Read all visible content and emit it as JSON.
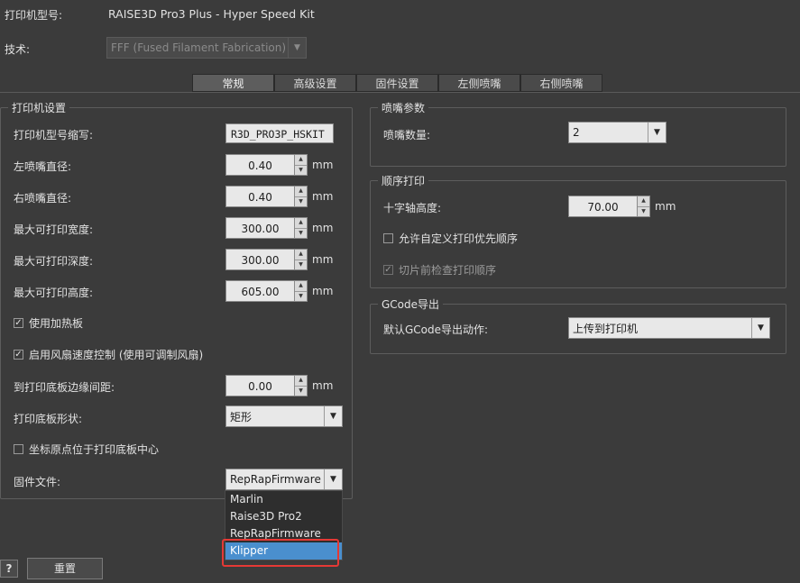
{
  "header": {
    "printer_model_label": "打印机型号:",
    "printer_model_value": "RAISE3D Pro3 Plus - Hyper Speed Kit",
    "technology_label": "技术:",
    "technology_value": "FFF (Fused Filament Fabrication)"
  },
  "tabs": [
    "常规",
    "高级设置",
    "固件设置",
    "左侧喷嘴",
    "右侧喷嘴"
  ],
  "printer_settings": {
    "title": "打印机设置",
    "abbr_label": "打印机型号缩写:",
    "abbr_value": "R3D_PRO3P_HSKIT",
    "left_nozzle_label": "左喷嘴直径:",
    "left_nozzle_value": "0.40",
    "right_nozzle_label": "右喷嘴直径:",
    "right_nozzle_value": "0.40",
    "max_width_label": "最大可打印宽度:",
    "max_width_value": "300.00",
    "max_depth_label": "最大可打印深度:",
    "max_depth_value": "300.00",
    "max_height_label": "最大可打印高度:",
    "max_height_value": "605.00",
    "unit": "mm",
    "heated_bed_label": "使用加热板",
    "fan_control_label": "启用风扇速度控制 (使用可调制风扇)",
    "bed_margin_label": "到打印底板边缘间距:",
    "bed_margin_value": "0.00",
    "bed_shape_label": "打印底板形状:",
    "bed_shape_value": "矩形",
    "origin_center_label": "坐标原点位于打印底板中心",
    "firmware_label": "固件文件:",
    "firmware_value": "RepRapFirmware",
    "firmware_options": [
      "Marlin",
      "Raise3D Pro2",
      "RepRapFirmware",
      "Klipper"
    ]
  },
  "nozzle_params": {
    "title": "喷嘴参数",
    "count_label": "喷嘴数量:",
    "count_value": "2"
  },
  "sequential": {
    "title": "顺序打印",
    "gantry_label": "十字轴高度:",
    "gantry_value": "70.00",
    "unit": "mm",
    "custom_order_label": "允许自定义打印优先顺序",
    "check_order_label": "切片前检查打印顺序"
  },
  "gcode": {
    "title": "GCode导出",
    "default_action_label": "默认GCode导出动作:",
    "default_action_value": "上传到打印机"
  },
  "footer": {
    "help_label": "?",
    "reset_label": "重置"
  },
  "colors": {
    "background": "#3b3b3b",
    "selection": "#4a8fce",
    "highlight": "#e53935"
  }
}
